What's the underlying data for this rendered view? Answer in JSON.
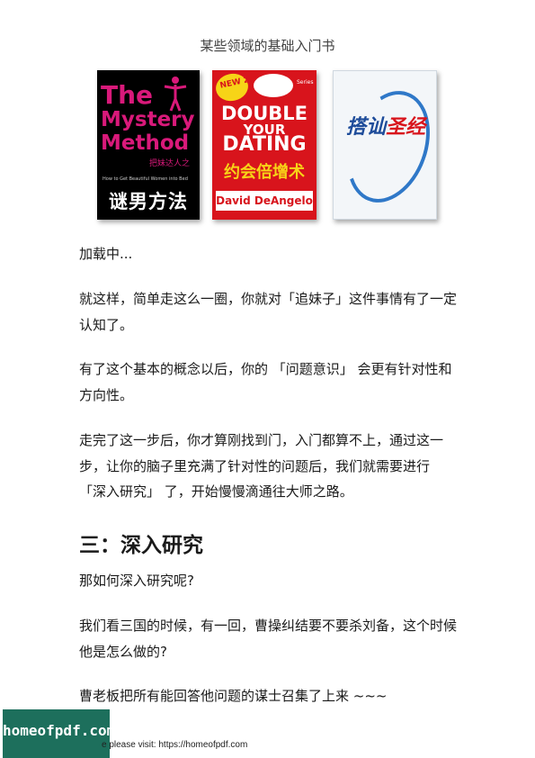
{
  "caption": "某些领域的基础入门书",
  "books": [
    {
      "title_lines": [
        "The",
        "Mystery",
        "Method"
      ],
      "subtitle_cn": "把妹达人之",
      "tagline": "How to Get Beautiful Women into Bed",
      "title_cn": "谜男方法"
    },
    {
      "badge": "NEW 2nd Edition",
      "series_logo": "DOUBLE YOUR DATING",
      "series_label": "Series",
      "title_line1": "DOUBLE",
      "title_line2": "YOUR",
      "title_line3": "DATING",
      "title_cn": "约会倍增术",
      "author": "David DeAngelo"
    },
    {
      "title_cn_part1": "搭讪",
      "title_cn_part2": "圣经"
    }
  ],
  "paragraphs": [
    "加载中...",
    "就这样，简单走这么一圈，你就对「追妹子」这件事情有了一定认知了。",
    "有了这个基本的概念以后，你的 「问题意识」 会更有针对性和方向性。",
    "走完了这一步后，你才算刚找到门，入门都算不上，通过这一步，让你的脑子里充满了针对性的问题后，我们就需要进行 「深入研究」 了，开始慢慢滴通往大师之路。"
  ],
  "heading": "三：深入研究",
  "paragraphs2": [
    "那如何深入研究呢?",
    "我们看三国的时候，有一回，曹操纠结要不要杀刘备，这个时候他是怎么做的?",
    "曹老板把所有能回答他问题的谋士召集了上来 ~~~"
  ],
  "watermark": {
    "logo": "homeofpdf.com",
    "footer": "e please visit: https://homeofpdf.com"
  }
}
